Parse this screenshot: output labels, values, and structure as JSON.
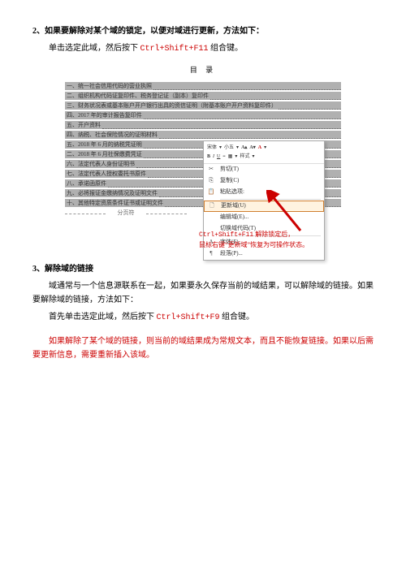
{
  "section2": {
    "heading_num": "2、",
    "heading_text": "如果要解除对某个域的锁定，以便对域进行更新，方法如下：",
    "line1_a": "单击选定此域，然后按下 ",
    "line1_key": "Ctrl+Shift+F11",
    "line1_b": " 组合键。"
  },
  "toc": {
    "title": "目 录",
    "items": [
      "一、统一社会信用代码的营业执照",
      "二、组织机构代码证复印件、税务登记证（副本）复印件",
      "三、财务状况表或基本账户开户银行出具的资信证明（附基本账户开户资料复印件）",
      "四、2017 年的审计报告复印件",
      "五、开户资料",
      "四、纳税、社会保险情况的证明材料",
      "五、2018 年 6 月的纳税凭证明",
      "二、2018 年 6 月社保缴费凭证",
      "六、法定代表人身份证明书",
      "七、法定代表人授权委托书原件",
      "八、承诺函原件",
      "九、必将报证金缴纳情况及证明文件",
      "十、其他特定资质条件证书或证明文件"
    ],
    "page_break": "分页符"
  },
  "context_menu": {
    "toolbar": {
      "font": "宋体",
      "size": "小五",
      "a_glyph": "A",
      "b": "B",
      "i": "I",
      "u": "U"
    },
    "items": [
      {
        "icon": "✂",
        "label": "剪切(T)"
      },
      {
        "icon": "⎘",
        "label": "复制(C)"
      },
      {
        "icon": "📋",
        "label": "粘贴选项:"
      },
      {
        "icon": "🗋",
        "label": "更新域(U)",
        "highlighted": true
      },
      {
        "icon": "",
        "label": "编辑域(E)..."
      },
      {
        "icon": "",
        "label": "切换域代码(T)"
      },
      {
        "icon": "A",
        "label": "字体(F)..."
      },
      {
        "icon": "¶",
        "label": "段落(P)..."
      }
    ]
  },
  "annotation": {
    "line1_a": "Ctrl+Shift+F11",
    "line1_b": " 解除锁定后，",
    "line2": "鼠标右键“更新域”恢复为可操作状态。"
  },
  "section3": {
    "heading_num": "3、",
    "heading_text": "解除域的链接",
    "p1": "域通常与一个信息源联系在一起，如果要永久保存当前的域结果，可以解除域的链接。如果要解除域的链接，方法如下：",
    "p2_a": "首先单击选定此域，然后按下 ",
    "p2_key": "Ctrl+Shift+F9",
    "p2_b": " 组合键。",
    "warn": "如果解除了某个域的链接，则当前的域结果成为常规文本，而且不能恢复链接。如果以后需要更新信息，需要重新插入该域。"
  }
}
